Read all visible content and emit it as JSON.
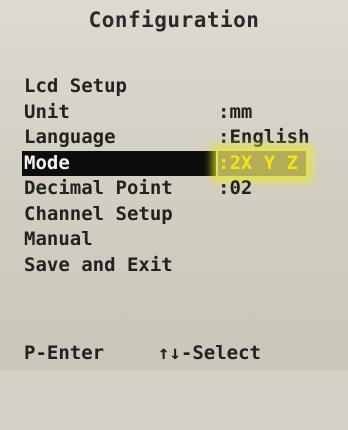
{
  "title": "Configuration",
  "menu": {
    "items": [
      {
        "label": "Lcd Setup",
        "value": ""
      },
      {
        "label": "Unit",
        "value": ":mm"
      },
      {
        "label": "Language",
        "value": ":English"
      },
      {
        "label": "Mode",
        "value": ":2X Y Z"
      },
      {
        "label": "Decimal Point",
        "value": ":02"
      },
      {
        "label": "Channel Setup",
        "value": ""
      },
      {
        "label": "Manual",
        "value": ""
      },
      {
        "label": "Save and Exit",
        "value": ""
      }
    ],
    "selected_label": "Mode"
  },
  "footer": {
    "enter_hint": "P-Enter",
    "select_hint": "↑↓-Select"
  },
  "colors": {
    "background": "#d6d1c6",
    "text": "#232323",
    "selection_background": "#0d0d0d",
    "selection_text": "#f2f2f2",
    "value_highlight": "#f4e417"
  }
}
